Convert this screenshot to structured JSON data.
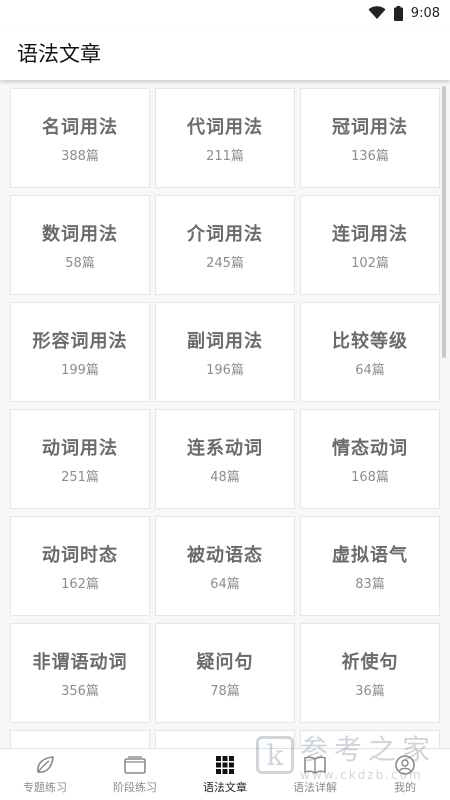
{
  "status_bar": {
    "time": "9:08"
  },
  "app_bar": {
    "title": "语法文章"
  },
  "categories": [
    {
      "name": "名词用法",
      "count": "388篇"
    },
    {
      "name": "代词用法",
      "count": "211篇"
    },
    {
      "name": "冠词用法",
      "count": "136篇"
    },
    {
      "name": "数词用法",
      "count": "58篇"
    },
    {
      "name": "介词用法",
      "count": "245篇"
    },
    {
      "name": "连词用法",
      "count": "102篇"
    },
    {
      "name": "形容词用法",
      "count": "199篇"
    },
    {
      "name": "副词用法",
      "count": "196篇"
    },
    {
      "name": "比较等级",
      "count": "64篇"
    },
    {
      "name": "动词用法",
      "count": "251篇"
    },
    {
      "name": "连系动词",
      "count": "48篇"
    },
    {
      "name": "情态动词",
      "count": "168篇"
    },
    {
      "name": "动词时态",
      "count": "162篇"
    },
    {
      "name": "被动语态",
      "count": "64篇"
    },
    {
      "name": "虚拟语气",
      "count": "83篇"
    },
    {
      "name": "非谓语动词",
      "count": "356篇"
    },
    {
      "name": "疑问句",
      "count": "78篇"
    },
    {
      "name": "祈使句",
      "count": "36篇"
    },
    {
      "name": "",
      "count": ""
    },
    {
      "name": "",
      "count": ""
    },
    {
      "name": "",
      "count": ""
    }
  ],
  "bottom_nav": [
    {
      "label": "专题练习",
      "icon": "leaf-icon"
    },
    {
      "label": "阶段练习",
      "icon": "folder-icon"
    },
    {
      "label": "语法文章",
      "icon": "grid-icon",
      "active": true
    },
    {
      "label": "语法详解",
      "icon": "book-icon"
    },
    {
      "label": "我的",
      "icon": "person-icon"
    }
  ],
  "watermark": {
    "logo_letter": "k",
    "text": "参考之家",
    "url": "www.ckdzb.com"
  }
}
